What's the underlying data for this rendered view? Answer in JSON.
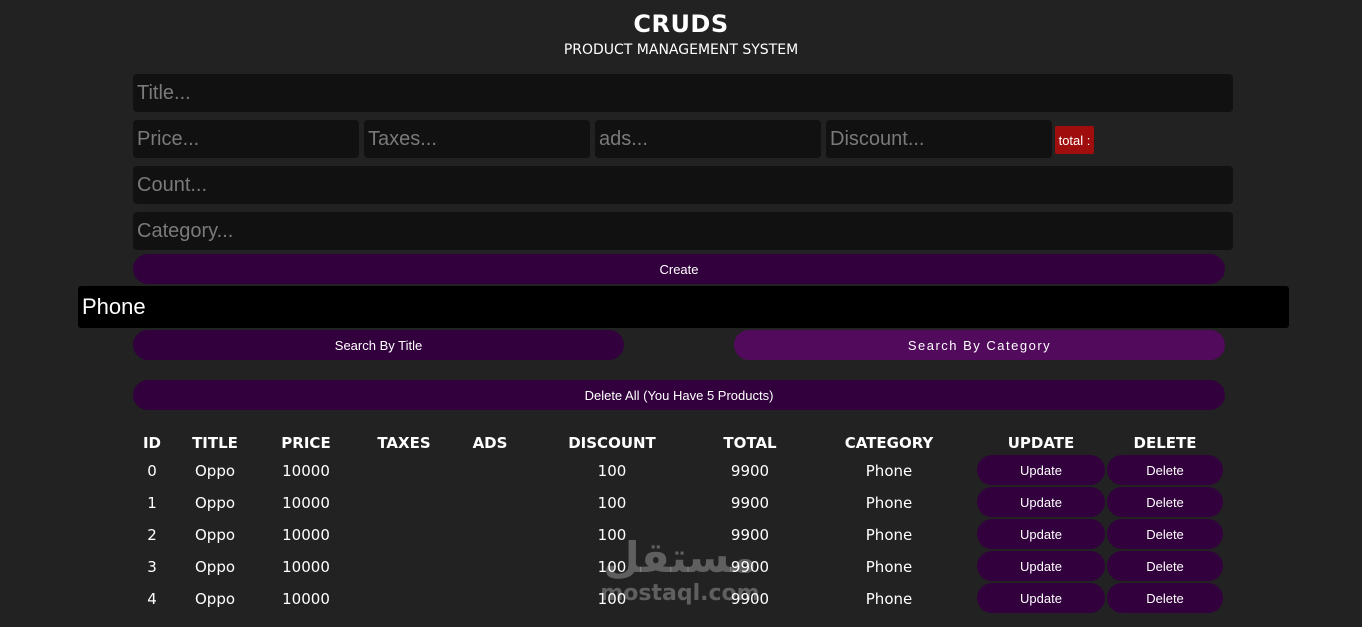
{
  "header": {
    "title": "CRUDS",
    "subtitle": "PRODUCT MANAGEMENT SYSTEM"
  },
  "form": {
    "title_placeholder": "Title...",
    "price_placeholder": "Price...",
    "taxes_placeholder": "Taxes...",
    "ads_placeholder": "ads...",
    "discount_placeholder": "Discount...",
    "total_label": "total :",
    "count_placeholder": "Count...",
    "category_placeholder": "Category...",
    "create_label": "Create"
  },
  "search": {
    "value": "Phone",
    "by_title_label": "Search By Title",
    "by_category_label": "Search By Category"
  },
  "delete_all_label": "Delete All (You Have 5 Products)",
  "table": {
    "headers": [
      "ID",
      "TITLE",
      "PRICE",
      "TAXES",
      "ADS",
      "DISCOUNT",
      "TOTAL",
      "CATEGORY",
      "UPDATE",
      "DELETE"
    ],
    "rows": [
      {
        "id": "0",
        "title": "Oppo",
        "price": "10000",
        "taxes": "",
        "ads": "",
        "discount": "100",
        "total": "9900",
        "category": "Phone",
        "update": "Update",
        "delete": "Delete"
      },
      {
        "id": "1",
        "title": "Oppo",
        "price": "10000",
        "taxes": "",
        "ads": "",
        "discount": "100",
        "total": "9900",
        "category": "Phone",
        "update": "Update",
        "delete": "Delete"
      },
      {
        "id": "2",
        "title": "Oppo",
        "price": "10000",
        "taxes": "",
        "ads": "",
        "discount": "100",
        "total": "9900",
        "category": "Phone",
        "update": "Update",
        "delete": "Delete"
      },
      {
        "id": "3",
        "title": "Oppo",
        "price": "10000",
        "taxes": "",
        "ads": "",
        "discount": "100",
        "total": "9900",
        "category": "Phone",
        "update": "Update",
        "delete": "Delete"
      },
      {
        "id": "4",
        "title": "Oppo",
        "price": "10000",
        "taxes": "",
        "ads": "",
        "discount": "100",
        "total": "9900",
        "category": "Phone",
        "update": "Update",
        "delete": "Delete"
      }
    ]
  },
  "watermark": {
    "arabic": "مستقل",
    "latin": "mostaql.com"
  },
  "colors": {
    "background": "#222222",
    "input_bg": "#111111",
    "button_dark": "#32003d",
    "button_purple": "#520a5c",
    "total_badge": "#a00d0d"
  }
}
